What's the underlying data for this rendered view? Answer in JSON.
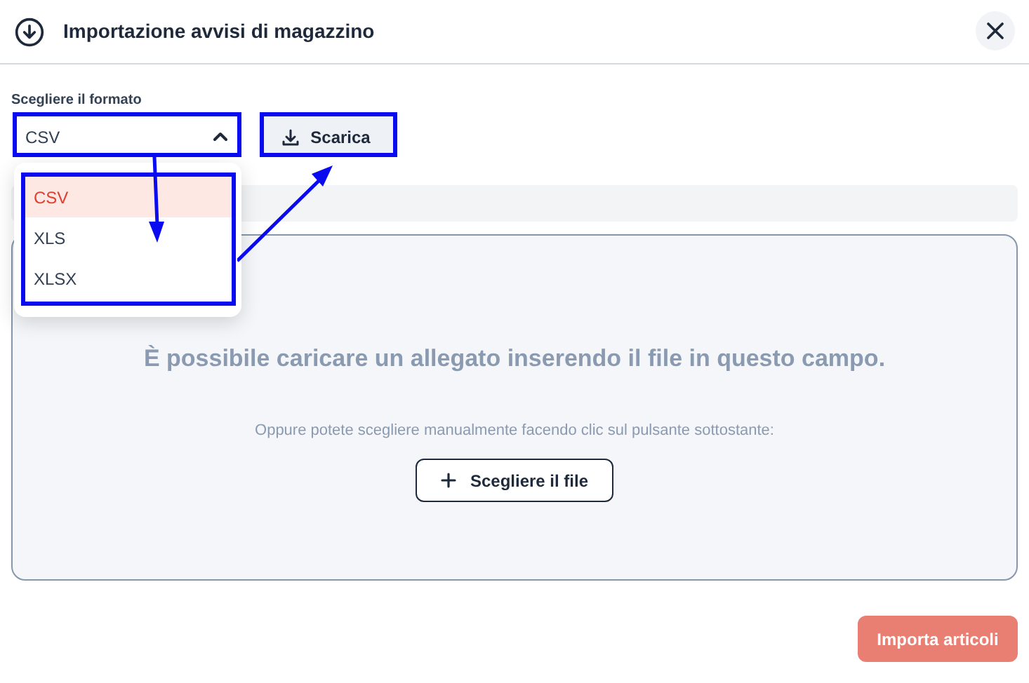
{
  "dialog": {
    "title": "Importazione avvisi di magazzino"
  },
  "format": {
    "label": "Scegliere il formato",
    "value": "CSV",
    "expanded": true,
    "options": [
      {
        "label": "CSV",
        "selected": true
      },
      {
        "label": "XLS",
        "selected": false
      },
      {
        "label": "XLSX",
        "selected": false
      }
    ]
  },
  "download_button": "Scarica",
  "drop_zone": {
    "headline": "È possibile caricare un allegato inserendo il file in questo campo.",
    "hint": "Oppure potete scegliere manualmente facendo clic sul pulsante sottostante:",
    "button": "Scegliere il file"
  },
  "import_button": {
    "label": "Importa articoli",
    "disabled": true
  }
}
